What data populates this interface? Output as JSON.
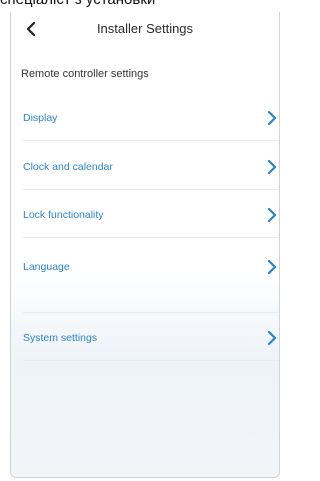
{
  "caption": "спеціаліст з установки",
  "header": {
    "title": "Installer Settings",
    "back_icon": "chevron-left-icon"
  },
  "section_label": "Remote controller settings",
  "items": [
    {
      "label": "Display",
      "icon": "chevron-right-icon"
    },
    {
      "label": "Clock and calendar",
      "icon": "chevron-right-icon"
    },
    {
      "label": "Lock functionality",
      "icon": "chevron-right-icon"
    },
    {
      "label": "Language",
      "icon": "chevron-right-icon"
    },
    {
      "label": "System settings",
      "icon": "chevron-right-icon"
    }
  ],
  "colors": {
    "accent": "#2c84c6",
    "text": "#2a2a2a"
  }
}
